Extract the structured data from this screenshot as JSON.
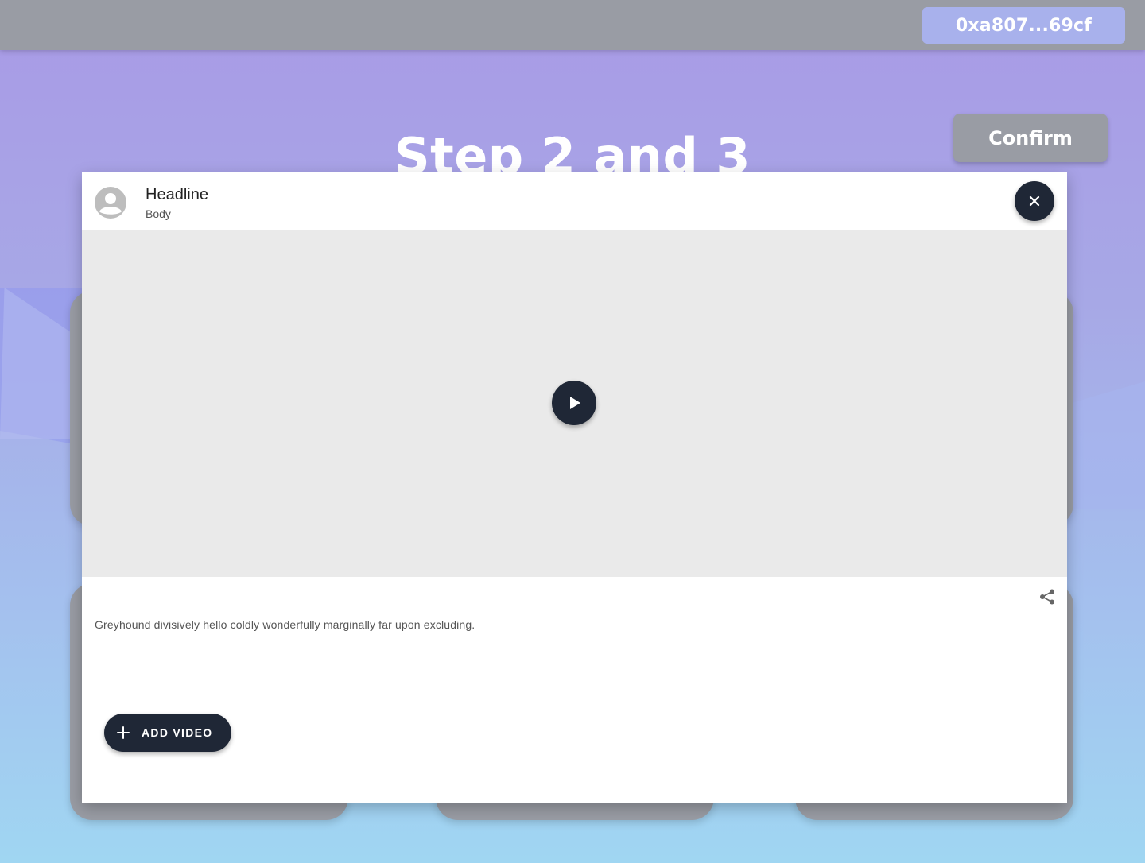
{
  "topbar": {
    "wallet_address": "0xa807...69cf"
  },
  "page": {
    "title": "Step 2 and 3",
    "confirm_label": "Confirm"
  },
  "modal": {
    "headline": "Headline",
    "body_label": "Body",
    "description": "Greyhound divisively hello coldly wonderfully marginally far upon excluding.",
    "add_video_label": "ADD VIDEO",
    "icons": {
      "avatar": "account-circle-icon",
      "close": "close-icon",
      "play": "play-icon",
      "share": "share-icon",
      "add": "plus-icon"
    }
  },
  "colors": {
    "topbar": "#999ca4",
    "wallet_button": "#a8b1ec",
    "dark_button": "#1f2736",
    "media_placeholder": "#eaeaea",
    "background_top": "#a99ae6",
    "background_bottom": "#a0d6f2"
  }
}
